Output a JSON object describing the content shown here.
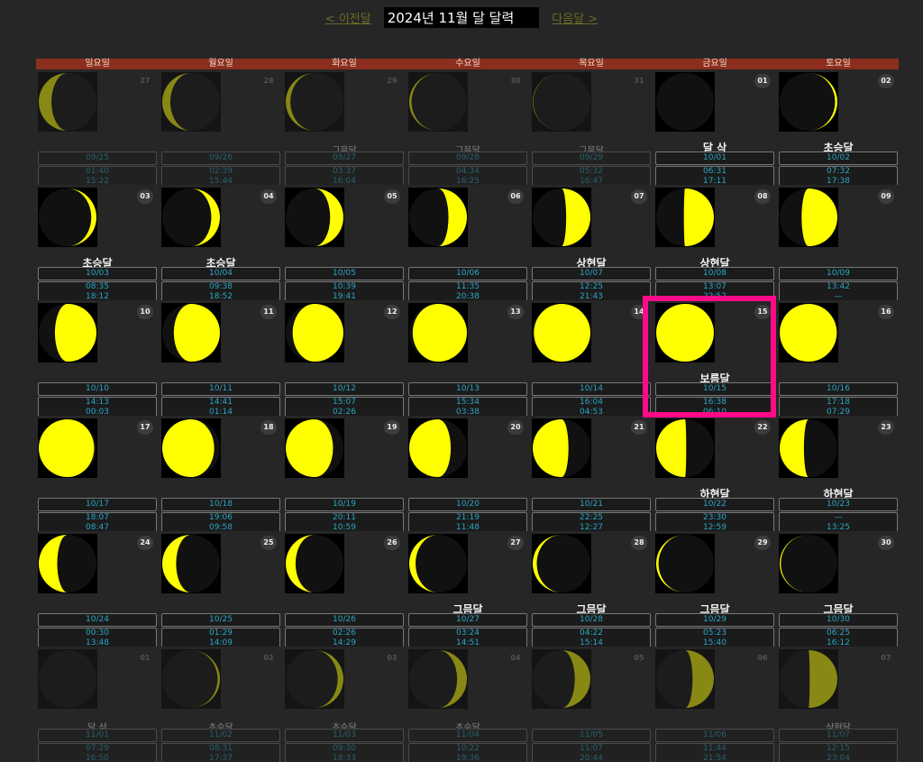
{
  "nav": {
    "prev": "< 이전달",
    "title": "2024년 11월 달 달력",
    "next": "다음달 >"
  },
  "weekdays": [
    "일요일",
    "월요일",
    "화요일",
    "수요일",
    "목요일",
    "금요일",
    "토요일"
  ],
  "colors": {
    "moon_lit": "#ffff00",
    "moon_dark": "#111111",
    "header_bar": "#8b2e1e",
    "highlight": "#ff0a88"
  },
  "calendar": [
    {
      "day": "27",
      "other": true,
      "phase": "",
      "lunar": "09/25",
      "rise": "01:40",
      "set": "15:22",
      "illum": 0.22,
      "waxing": false
    },
    {
      "day": "28",
      "other": true,
      "phase": "",
      "lunar": "09/26",
      "rise": "02:39",
      "set": "15:44",
      "illum": 0.14,
      "waxing": false
    },
    {
      "day": "29",
      "other": true,
      "phase": "그믐달",
      "lunar": "09/27",
      "rise": "03:37",
      "set": "16:04",
      "illum": 0.08,
      "waxing": false
    },
    {
      "day": "30",
      "other": true,
      "phase": "그믐달",
      "lunar": "09/28",
      "rise": "04:34",
      "set": "16:25",
      "illum": 0.04,
      "waxing": false
    },
    {
      "day": "31",
      "other": true,
      "phase": "그믐달",
      "lunar": "09/29",
      "rise": "05:32",
      "set": "16:47",
      "illum": 0.01,
      "waxing": false
    },
    {
      "day": "01",
      "other": false,
      "phase": "달 삭",
      "lunar": "10/01",
      "rise": "06:31",
      "set": "17:11",
      "illum": 0.0,
      "waxing": true
    },
    {
      "day": "02",
      "other": false,
      "phase": "초승달",
      "lunar": "10/02",
      "rise": "07:32",
      "set": "17:38",
      "illum": 0.04,
      "waxing": true
    },
    {
      "day": "03",
      "other": false,
      "phase": "초승달",
      "lunar": "10/03",
      "rise": "08:35",
      "set": "18:12",
      "illum": 0.09,
      "waxing": true
    },
    {
      "day": "04",
      "other": false,
      "phase": "초승달",
      "lunar": "10/04",
      "rise": "09:38",
      "set": "18:52",
      "illum": 0.15,
      "waxing": true
    },
    {
      "day": "05",
      "other": false,
      "phase": "",
      "lunar": "10/05",
      "rise": "10:39",
      "set": "19:41",
      "illum": 0.23,
      "waxing": true
    },
    {
      "day": "06",
      "other": false,
      "phase": "",
      "lunar": "10/06",
      "rise": "11:35",
      "set": "20:38",
      "illum": 0.32,
      "waxing": true
    },
    {
      "day": "07",
      "other": false,
      "phase": "상현달",
      "lunar": "10/07",
      "rise": "12:25",
      "set": "21:43",
      "illum": 0.42,
      "waxing": true
    },
    {
      "day": "08",
      "other": false,
      "phase": "상현달",
      "lunar": "10/08",
      "rise": "13:07",
      "set": "22:52",
      "illum": 0.52,
      "waxing": true
    },
    {
      "day": "09",
      "other": false,
      "phase": "",
      "lunar": "10/09",
      "rise": "13:42",
      "set": "—",
      "illum": 0.62,
      "waxing": true
    },
    {
      "day": "10",
      "other": false,
      "phase": "",
      "lunar": "10/10",
      "rise": "14:13",
      "set": "00:03",
      "illum": 0.72,
      "waxing": true
    },
    {
      "day": "11",
      "other": false,
      "phase": "",
      "lunar": "10/11",
      "rise": "14:41",
      "set": "01:14",
      "illum": 0.8,
      "waxing": true
    },
    {
      "day": "12",
      "other": false,
      "phase": "",
      "lunar": "10/12",
      "rise": "15:07",
      "set": "02:26",
      "illum": 0.88,
      "waxing": true
    },
    {
      "day": "13",
      "other": false,
      "phase": "",
      "lunar": "10/13",
      "rise": "15:34",
      "set": "03:38",
      "illum": 0.94,
      "waxing": true
    },
    {
      "day": "14",
      "other": false,
      "phase": "",
      "lunar": "10/14",
      "rise": "16:04",
      "set": "04:53",
      "illum": 0.98,
      "waxing": true
    },
    {
      "day": "15",
      "other": false,
      "phase": "보름달",
      "lunar": "10/15",
      "rise": "16:38",
      "set": "06:10",
      "illum": 1.0,
      "waxing": true
    },
    {
      "day": "16",
      "other": false,
      "phase": "",
      "lunar": "10/16",
      "rise": "17:18",
      "set": "07:29",
      "illum": 0.99,
      "waxing": false
    },
    {
      "day": "17",
      "other": false,
      "phase": "",
      "lunar": "10/17",
      "rise": "18:07",
      "set": "08:47",
      "illum": 0.96,
      "waxing": false
    },
    {
      "day": "18",
      "other": false,
      "phase": "",
      "lunar": "10/18",
      "rise": "19:06",
      "set": "09:58",
      "illum": 0.9,
      "waxing": false
    },
    {
      "day": "19",
      "other": false,
      "phase": "",
      "lunar": "10/19",
      "rise": "20:11",
      "set": "10:59",
      "illum": 0.82,
      "waxing": false
    },
    {
      "day": "20",
      "other": false,
      "phase": "",
      "lunar": "10/20",
      "rise": "21:19",
      "set": "11:48",
      "illum": 0.72,
      "waxing": false
    },
    {
      "day": "21",
      "other": false,
      "phase": "",
      "lunar": "10/21",
      "rise": "22:25",
      "set": "12:27",
      "illum": 0.62,
      "waxing": false
    },
    {
      "day": "22",
      "other": false,
      "phase": "하현달",
      "lunar": "10/22",
      "rise": "23:30",
      "set": "12:59",
      "illum": 0.52,
      "waxing": false
    },
    {
      "day": "23",
      "other": false,
      "phase": "하현달",
      "lunar": "10/23",
      "rise": "—",
      "set": "13:25",
      "illum": 0.42,
      "waxing": false
    },
    {
      "day": "24",
      "other": false,
      "phase": "",
      "lunar": "10/24",
      "rise": "00:30",
      "set": "13:48",
      "illum": 0.32,
      "waxing": false
    },
    {
      "day": "25",
      "other": false,
      "phase": "",
      "lunar": "10/25",
      "rise": "01:29",
      "set": "14:09",
      "illum": 0.24,
      "waxing": false
    },
    {
      "day": "26",
      "other": false,
      "phase": "",
      "lunar": "10/26",
      "rise": "02:26",
      "set": "14:29",
      "illum": 0.17,
      "waxing": false
    },
    {
      "day": "27",
      "other": false,
      "phase": "그믐달",
      "lunar": "10/27",
      "rise": "03:24",
      "set": "14:51",
      "illum": 0.11,
      "waxing": false
    },
    {
      "day": "28",
      "other": false,
      "phase": "그믐달",
      "lunar": "10/28",
      "rise": "04:22",
      "set": "15:14",
      "illum": 0.07,
      "waxing": false
    },
    {
      "day": "29",
      "other": false,
      "phase": "그믐달",
      "lunar": "10/29",
      "rise": "05:23",
      "set": "15:40",
      "illum": 0.04,
      "waxing": false
    },
    {
      "day": "30",
      "other": false,
      "phase": "그믐달",
      "lunar": "10/30",
      "rise": "06:25",
      "set": "16:12",
      "illum": 0.02,
      "waxing": false
    },
    {
      "day": "01",
      "other": true,
      "phase": "달 삭",
      "lunar": "11/01",
      "rise": "07:29",
      "set": "16:50",
      "illum": 0.0,
      "waxing": true
    },
    {
      "day": "02",
      "other": true,
      "phase": "초승달",
      "lunar": "11/02",
      "rise": "08:31",
      "set": "17:37",
      "illum": 0.04,
      "waxing": true
    },
    {
      "day": "03",
      "other": true,
      "phase": "초승달",
      "lunar": "11/03",
      "rise": "09:30",
      "set": "18:33",
      "illum": 0.1,
      "waxing": true
    },
    {
      "day": "04",
      "other": true,
      "phase": "초승달",
      "lunar": "11/04",
      "rise": "10:22",
      "set": "19:36",
      "illum": 0.17,
      "waxing": true
    },
    {
      "day": "05",
      "other": true,
      "phase": "",
      "lunar": "11/05",
      "rise": "11:07",
      "set": "20:44",
      "illum": 0.27,
      "waxing": true
    },
    {
      "day": "06",
      "other": true,
      "phase": "",
      "lunar": "11/06",
      "rise": "11:44",
      "set": "21:54",
      "illum": 0.37,
      "waxing": true
    },
    {
      "day": "07",
      "other": true,
      "phase": "상현달",
      "lunar": "11/07",
      "rise": "12:15",
      "set": "23:04",
      "illum": 0.48,
      "waxing": true
    }
  ]
}
